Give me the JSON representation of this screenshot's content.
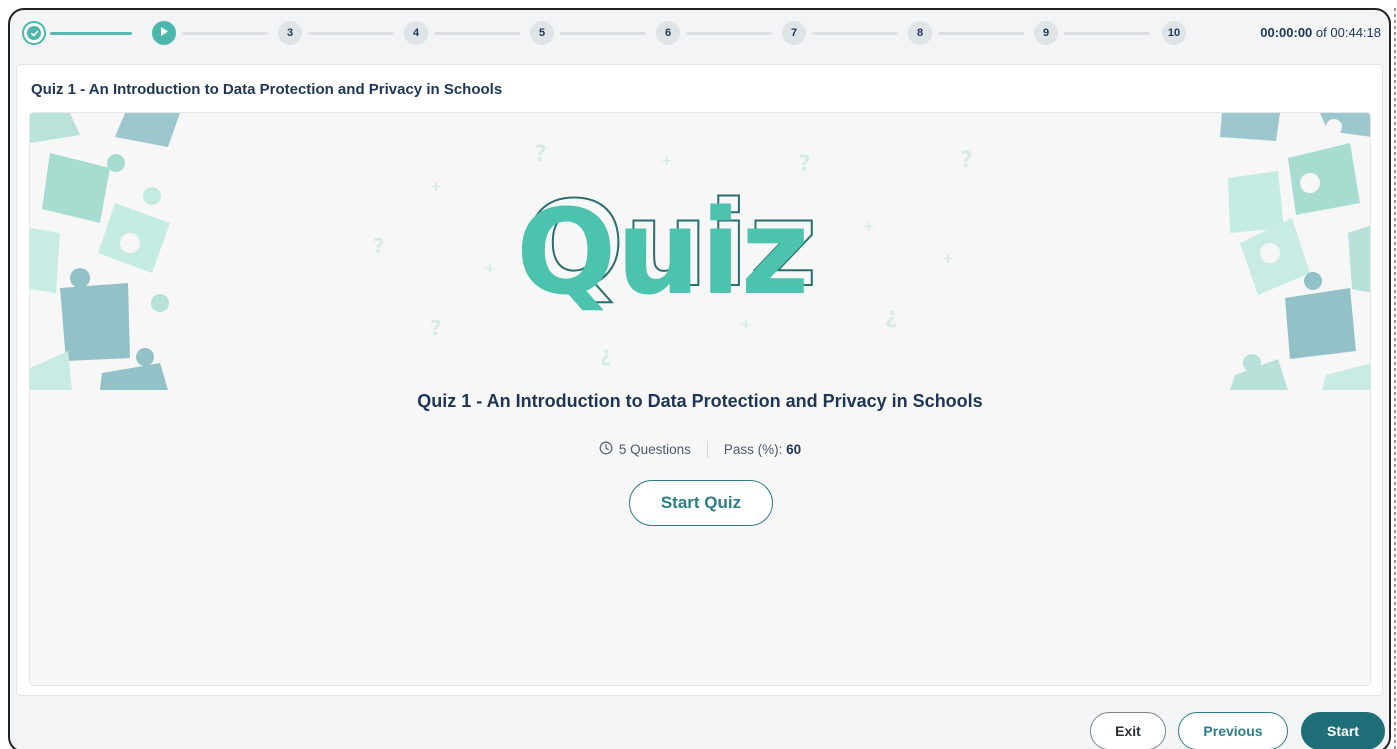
{
  "progress": {
    "steps": [
      {
        "label": "",
        "state": "done"
      },
      {
        "label": "",
        "state": "current"
      },
      {
        "label": "3",
        "state": "pending"
      },
      {
        "label": "4",
        "state": "pending"
      },
      {
        "label": "5",
        "state": "pending"
      },
      {
        "label": "6",
        "state": "pending"
      },
      {
        "label": "7",
        "state": "pending"
      },
      {
        "label": "8",
        "state": "pending"
      },
      {
        "label": "9",
        "state": "pending"
      },
      {
        "label": "10",
        "state": "pending"
      }
    ]
  },
  "timer": {
    "elapsed": "00:00:00",
    "separator": "of",
    "total": "00:44:18"
  },
  "panel": {
    "title": "Quiz 1 - An Introduction to Data Protection and Privacy in Schools"
  },
  "quiz": {
    "banner_word": "Quiz",
    "heading": "Quiz 1 - An Introduction to Data Protection and Privacy in Schools",
    "questions": "5 Questions",
    "pass_label": "Pass (%):",
    "pass_value": "60",
    "start_label": "Start Quiz"
  },
  "footer": {
    "exit_label": "Exit",
    "previous_label": "Previous",
    "start_label": "Start"
  },
  "colors": {
    "accent": "#4cb8ad",
    "primary": "#1f6f78",
    "text": "#1e3556"
  }
}
